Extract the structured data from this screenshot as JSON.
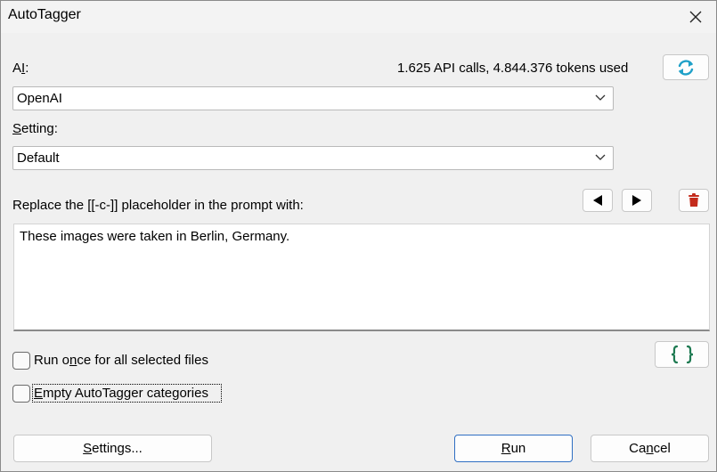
{
  "window": {
    "title": "AutoTagger"
  },
  "ai": {
    "label_prefix": "A",
    "label_u": "I",
    "label_suffix": ":",
    "usage": "1.625 API calls, 4.844.376 tokens used",
    "selected": "OpenAI"
  },
  "setting": {
    "label_u": "S",
    "label_rest": "etting:",
    "selected": "Default"
  },
  "prompt": {
    "label": "Replace the [[-c-]] placeholder in the prompt with:",
    "value": "These images were taken in Berlin, Germany."
  },
  "options": {
    "run_once": {
      "pre": "Run o",
      "u": "n",
      "post": "ce for all selected files",
      "checked": false
    },
    "empty_cats": {
      "u": "E",
      "post": "mpty AutoTagger categories",
      "checked": false
    }
  },
  "buttons": {
    "settings": {
      "u": "S",
      "post": "ettings..."
    },
    "run": {
      "u": "R",
      "post": "un"
    },
    "cancel": {
      "pre": "Ca",
      "u": "n",
      "post": "cel"
    }
  },
  "icons": {
    "refresh": "refresh-icon",
    "prev": "triangle-left-icon",
    "next": "triangle-right-icon",
    "delete": "trash-icon",
    "braces": "curly-braces-icon",
    "close": "close-icon",
    "chevron": "chevron-down-icon"
  },
  "colors": {
    "refresh": "#1fa0c8",
    "delete": "#c42b1c",
    "braces": "#1e7a52",
    "primary_border": "#2f6fc3"
  }
}
